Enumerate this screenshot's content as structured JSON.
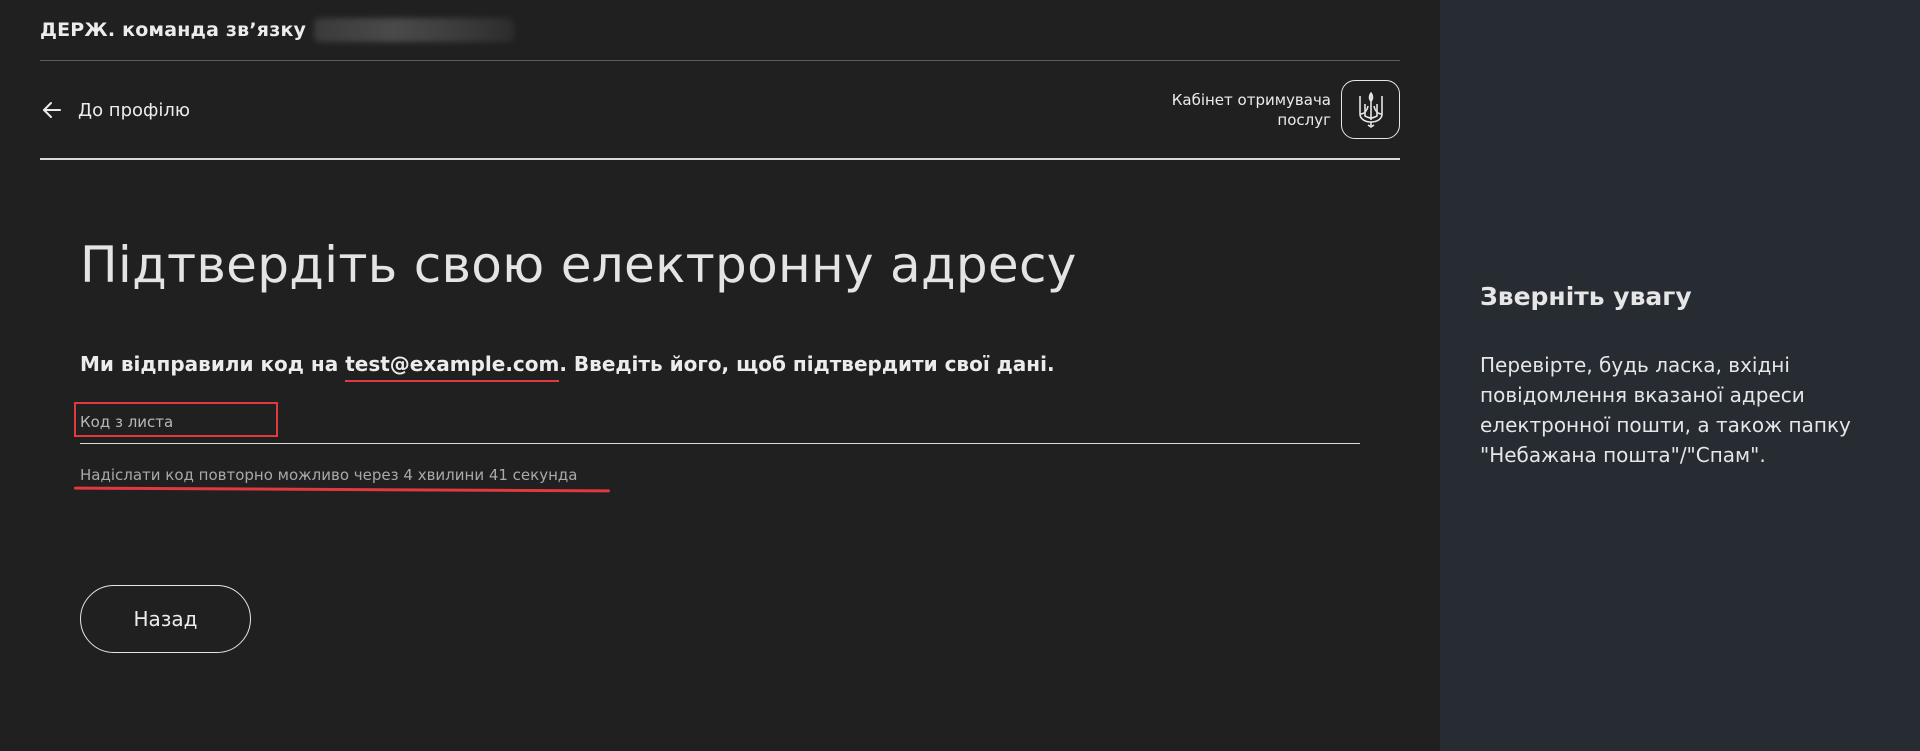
{
  "topbar": {
    "title": "ДЕРЖ. команда зв’язку"
  },
  "nav": {
    "back_label": "До профілю",
    "cabinet_line1": "Кабінет отримувача",
    "cabinet_line2": "послуг"
  },
  "content": {
    "title": "Підтвердіть свою електронну адресу",
    "intro_before": "Ми відправили код на ",
    "email": "test@example.com",
    "intro_after": ". Введіть його, щоб підтвердити свої дані.",
    "code_placeholder": "Код з листа",
    "resend_text": "Надіслати код повторно можливо через 4 хвилини 41 секунда",
    "back_button": "Назад"
  },
  "aside": {
    "title": "Зверніть увагу",
    "text": "Перевірте, будь ласка, вхідні повідомлення вказаної адреси електронної пошти, а також папку \"Небажана пошта\"/\"Спам\"."
  },
  "colors": {
    "main_bg": "#202020",
    "aside_bg": "#272c33",
    "highlight": "#e0393e"
  }
}
